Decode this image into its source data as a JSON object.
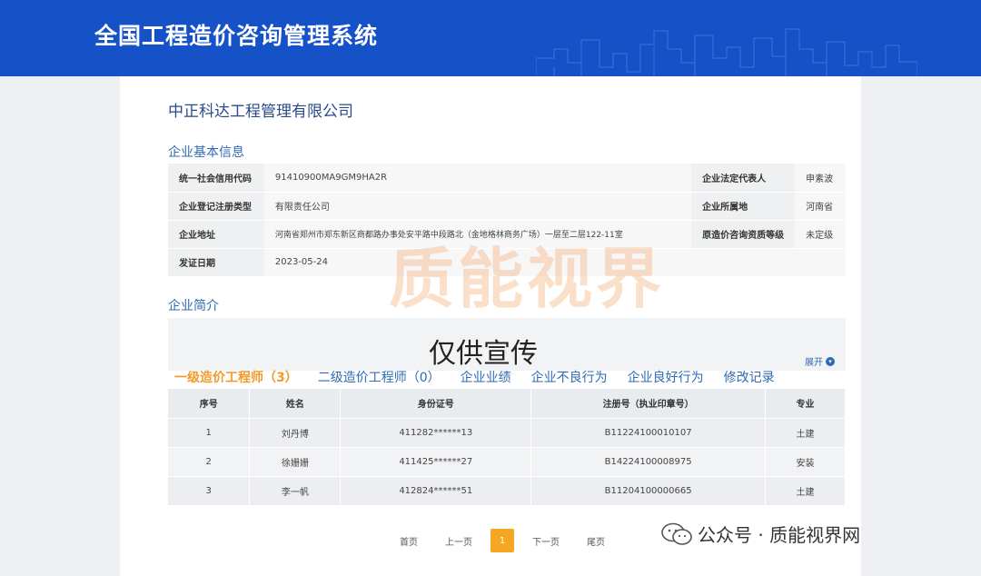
{
  "header": {
    "title": "全国工程造价咨询管理系统"
  },
  "company": {
    "name": "中正科达工程管理有限公司"
  },
  "basic_info": {
    "section_title": "企业基本信息",
    "rows": [
      {
        "label1": "统一社会信用代码",
        "value1": "91410900MA9GM9HA2R",
        "label2": "企业法定代表人",
        "value2": "申素波"
      },
      {
        "label1": "企业登记注册类型",
        "value1": "有限责任公司",
        "label2": "企业所属地",
        "value2": "河南省"
      },
      {
        "label1": "企业地址",
        "value1": "河南省郑州市郑东新区商都路办事处安平路中段路北（金地格林商务广场）一层至二层122-11室",
        "label2": "原造价咨询资质等级",
        "value2": "未定级"
      },
      {
        "label1": "发证日期",
        "value1": "2023-05-24",
        "label2": "",
        "value2": ""
      }
    ]
  },
  "intro": {
    "section_title": "企业简介",
    "expand_label": "展开"
  },
  "tabs": [
    {
      "label": "一级造价工程师（3）"
    },
    {
      "label": "二级造价工程师（0）"
    },
    {
      "label": "企业业绩"
    },
    {
      "label": "企业不良行为"
    },
    {
      "label": "企业良好行为"
    },
    {
      "label": "修改记录"
    }
  ],
  "engineers": {
    "headers": [
      "序号",
      "姓名",
      "身份证号",
      "注册号（执业印章号）",
      "专业"
    ],
    "rows": [
      [
        "1",
        "刘丹博",
        "411282******13",
        "B11224100010107",
        "土建"
      ],
      [
        "2",
        "徐姗姗",
        "411425******27",
        "B14224100008975",
        "安装"
      ],
      [
        "3",
        "李一帆",
        "412824******51",
        "B11204100000665",
        "土建"
      ]
    ]
  },
  "pagination": {
    "first": "首页",
    "prev": "上一页",
    "current": "1",
    "next": "下一页",
    "last": "尾页"
  },
  "watermarks": {
    "big": "质能视界",
    "promo": "仅供宣传",
    "account": "公众号 · 质能视界网"
  },
  "colors": {
    "header_bg": "#1552c8",
    "link": "#2f6bb5",
    "active_tab": "#f39a2b",
    "page_current": "#f5a623"
  }
}
